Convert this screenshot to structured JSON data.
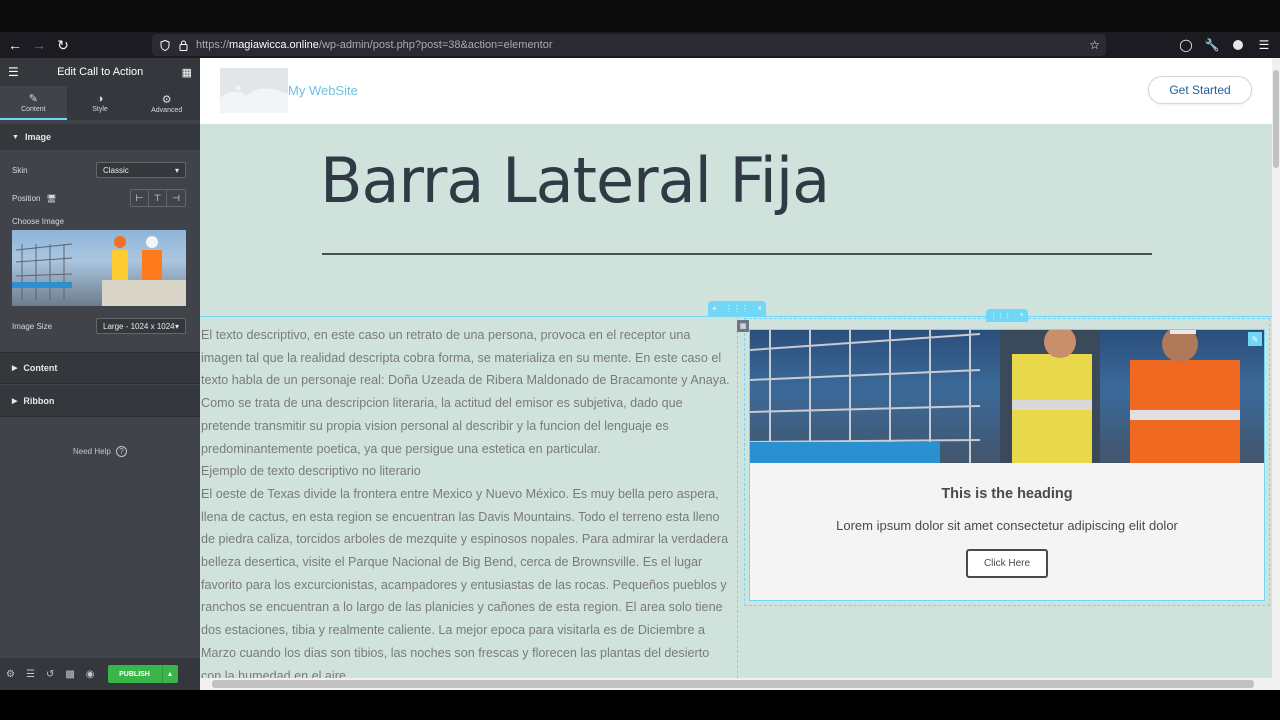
{
  "browser": {
    "url_prefix": "https://",
    "url_host": "magiawicca.online",
    "url_path": "/wp-admin/post.php?post=38&action=elementor"
  },
  "panel": {
    "title": "Edit Call to Action",
    "tabs": [
      {
        "label": "Content",
        "icon": "pencil-icon",
        "active": true
      },
      {
        "label": "Style",
        "icon": "half-circle-icon",
        "active": false
      },
      {
        "label": "Advanced",
        "icon": "gear-icon",
        "active": false
      }
    ],
    "image_section": "Image",
    "skin_label": "Skin",
    "skin_value": "Classic",
    "position_label": "Position",
    "choose_image_label": "Choose Image",
    "image_size_label": "Image Size",
    "image_size_value": "Large - 1024 x 1024",
    "content_section": "Content",
    "ribbon_section": "Ribbon",
    "need_help": "Need Help",
    "publish": "PUBLISH"
  },
  "site": {
    "name": "My WebSite",
    "cta_header": "Get Started",
    "page_title": "Barra Lateral Fija",
    "paragraphs": [
      "El texto descriptivo, en este caso un retrato de una persona, provoca en el receptor una imagen tal que la realidad descripta cobra forma, se materializa en su mente. En este caso el texto habla de un personaje real: Doña Uzeada de Ribera Maldonado de Bracamonte y Anaya. Como se trata de una descripcion literaria, la actitud del emisor es subjetiva, dado que pretende transmitir su propia vision personal al describir y la funcion del lenguaje es predominantemente poetica, ya que persigue una estetica en particular.",
      "Ejemplo de texto descriptivo no literario",
      "El oeste de Texas divide la frontera entre Mexico y Nuevo México. Es muy bella pero aspera, llena de cactus, en esta region se encuentran las Davis Mountains. Todo el terreno esta lleno de piedra caliza, torcidos arboles de mezquite y espinosos nopales. Para admirar la verdadera belleza desertica, visite el Parque Nacional de Big Bend, cerca de Brownsville. Es el lugar favorito para los excurcionistas, acampadores y entusiastas de las rocas. Pequeños pueblos y ranchos se encuentran a lo largo de las planicies y cañones de esta region. El area solo tiene dos estaciones, tibia y realmente caliente. La mejor epoca para visitarla es de Diciembre a Marzo cuando los dias son tibios, las noches son frescas y florecen las plantas del desierto con la humedad en el aire."
    ],
    "cta": {
      "heading": "This is the heading",
      "description": "Lorem ipsum dolor sit amet consectetur adipiscing elit dolor",
      "button": "Click Here"
    }
  },
  "colors": {
    "accent": "#71d7f7",
    "canvas_bg": "#cfe3dc",
    "publish": "#39b54a",
    "panel_bg": "#404349"
  }
}
